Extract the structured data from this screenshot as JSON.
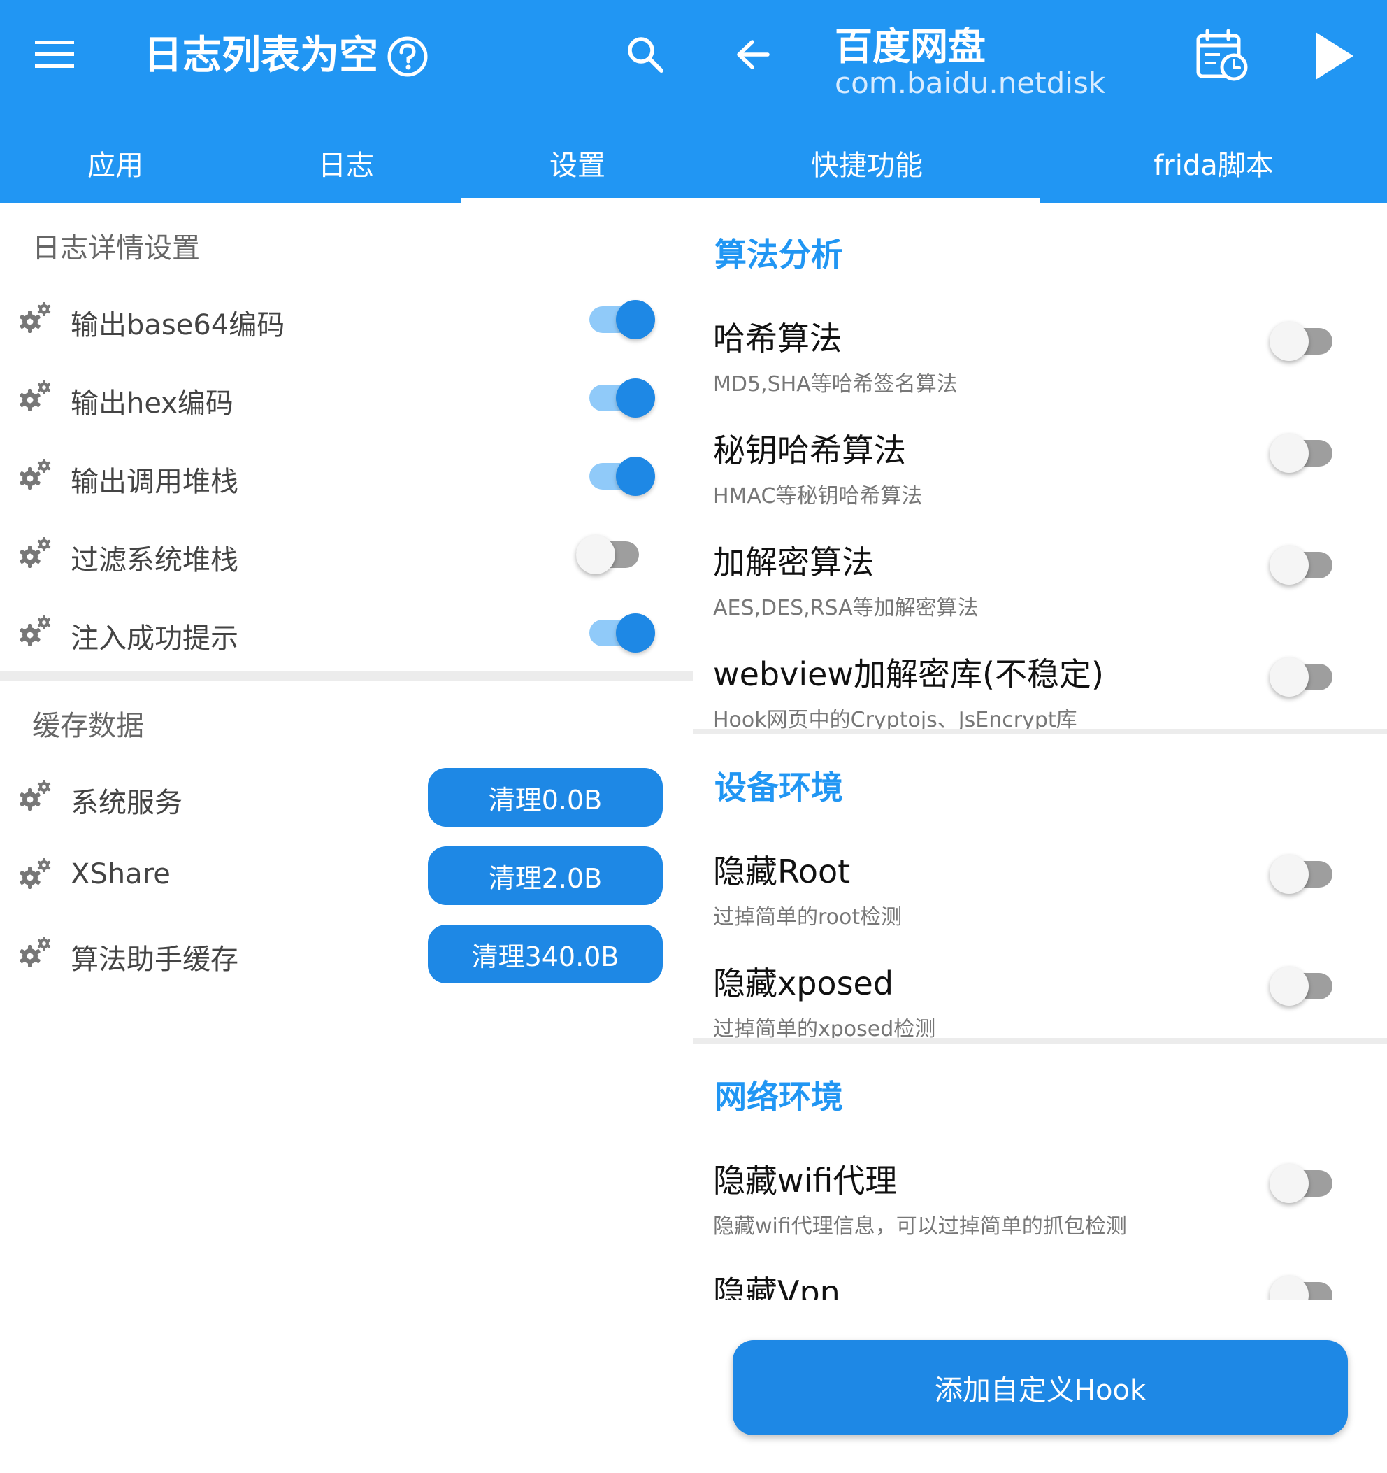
{
  "left": {
    "title": "日志列表为空",
    "help_icon": "help-circle-icon",
    "tabs": [
      {
        "label": "应用",
        "active": false
      },
      {
        "label": "日志",
        "active": false
      },
      {
        "label": "设置",
        "active": true
      }
    ],
    "log_settings": {
      "title": "日志详情设置",
      "items": [
        {
          "label": "输出base64编码",
          "on": true
        },
        {
          "label": "输出hex编码",
          "on": true
        },
        {
          "label": "输出调用堆栈",
          "on": true
        },
        {
          "label": "过滤系统堆栈",
          "on": false
        },
        {
          "label": "注入成功提示",
          "on": true
        }
      ]
    },
    "cache": {
      "title": "缓存数据",
      "items": [
        {
          "label": "系统服务",
          "button": "清理0.0B"
        },
        {
          "label": "XShare",
          "button": "清理2.0B"
        },
        {
          "label": "算法助手缓存",
          "button": "清理340.0B"
        }
      ]
    }
  },
  "right": {
    "app_name": "百度网盘",
    "package": "com.baidu.netdisk",
    "tabs": [
      {
        "label": "快捷功能",
        "active": true
      },
      {
        "label": "frida脚本",
        "active": false
      }
    ],
    "sections": [
      {
        "title": "算法分析",
        "items": [
          {
            "title": "哈希算法",
            "desc": "MD5,SHA等哈希签名算法",
            "on": false
          },
          {
            "title": "秘钥哈希算法",
            "desc": "HMAC等秘钥哈希算法",
            "on": false
          },
          {
            "title": "加解密算法",
            "desc": "AES,DES,RSA等加解密算法",
            "on": false
          },
          {
            "title": "webview加解密库(不稳定)",
            "desc": "Hook网页中的Cryptojs、JsEncrypt库",
            "on": false
          }
        ]
      },
      {
        "title": "设备环境",
        "items": [
          {
            "title": "隐藏Root",
            "desc": "过掉简单的root检测",
            "on": false
          },
          {
            "title": "隐藏xposed",
            "desc": "过掉简单的xposed检测",
            "on": false
          }
        ]
      },
      {
        "title": "网络环境",
        "items": [
          {
            "title": "隐藏wifi代理",
            "desc": "隐藏wifi代理信息，可以过掉简单的抓包检测",
            "on": false
          },
          {
            "title": "隐藏Vpn",
            "desc": "",
            "on": false
          }
        ]
      }
    ],
    "fab_label": "添加自定义Hook"
  },
  "colors": {
    "primary": "#2196f3",
    "accent": "#1e88e5",
    "switch_on_track": "#90caf9",
    "switch_off_track": "#9e9e9e",
    "switch_off_thumb": "#f5f5f5",
    "divider": "#ececec"
  }
}
